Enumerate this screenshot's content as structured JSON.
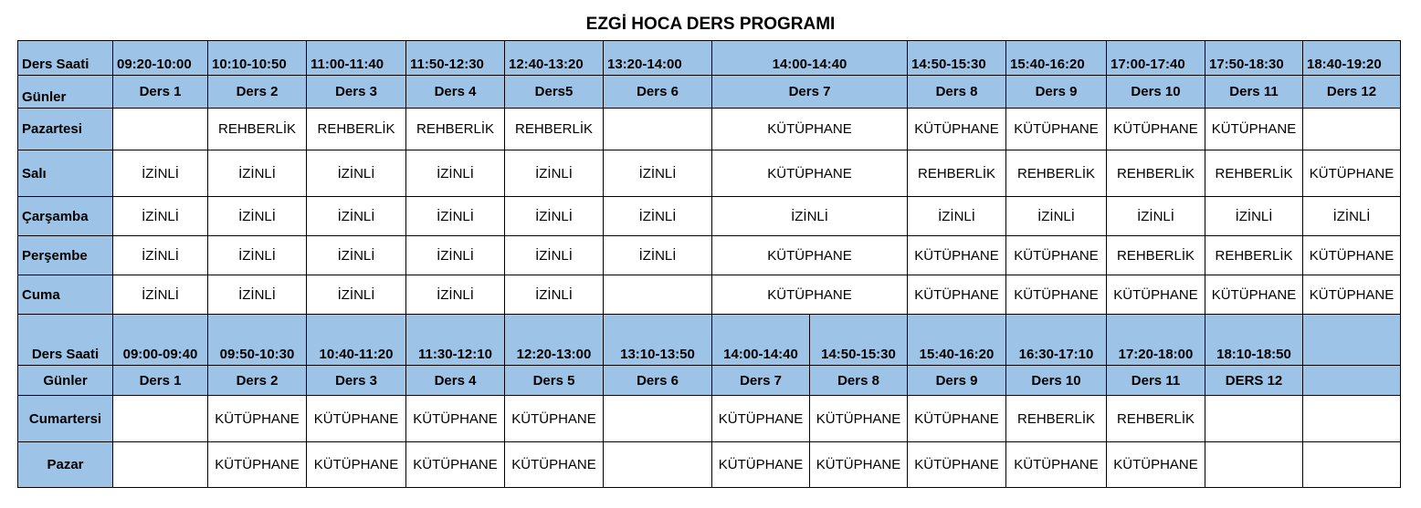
{
  "title": "EZGİ HOCA DERS PROGRAMI",
  "weekday": {
    "slot_header": "Ders Saati",
    "day_header": "Günler",
    "times": [
      "09:20-10:00",
      "10:10-10:50",
      "11:00-11:40",
      "11:50-12:30",
      "12:40-13:20",
      "13:20-14:00",
      "14:00-14:40",
      "14:50-15:30",
      "15:40-16:20",
      "17:00-17:40",
      "17:50-18:30",
      "18:40-19:20"
    ],
    "lessons": [
      "Ders 1",
      "Ders 2",
      "Ders 3",
      "Ders 4",
      "Ders5",
      "Ders 6",
      "Ders 7",
      "Ders 8",
      "Ders 9",
      "Ders 10",
      "Ders 11",
      "Ders 12"
    ],
    "rows": [
      {
        "day": "Pazartesi",
        "cells": [
          "",
          "REHBERLİK",
          "REHBERLİK",
          "REHBERLİK",
          "REHBERLİK",
          "",
          "KÜTÜPHANE",
          "KÜTÜPHANE",
          "KÜTÜPHANE",
          "KÜTÜPHANE",
          "KÜTÜPHANE",
          ""
        ]
      },
      {
        "day": "Salı",
        "cells": [
          "İZİNLİ",
          "İZİNLİ",
          "İZİNLİ",
          "İZİNLİ",
          "İZİNLİ",
          "İZİNLİ",
          "KÜTÜPHANE",
          "REHBERLİK",
          "REHBERLİK",
          "REHBERLİK",
          "REHBERLİK",
          "KÜTÜPHANE"
        ]
      },
      {
        "day": "Çarşamba",
        "cells": [
          "İZİNLİ",
          "İZİNLİ",
          "İZİNLİ",
          "İZİNLİ",
          "İZİNLİ",
          "İZİNLİ",
          "İZİNLİ",
          "İZİNLİ",
          "İZİNLİ",
          "İZİNLİ",
          "İZİNLİ",
          "İZİNLİ"
        ]
      },
      {
        "day": "Perşembe",
        "cells": [
          "İZİNLİ",
          "İZİNLİ",
          "İZİNLİ",
          "İZİNLİ",
          "İZİNLİ",
          "İZİNLİ",
          "KÜTÜPHANE",
          "KÜTÜPHANE",
          "KÜTÜPHANE",
          "REHBERLİK",
          "REHBERLİK",
          "KÜTÜPHANE"
        ]
      },
      {
        "day": "Cuma",
        "cells": [
          "İZİNLİ",
          "İZİNLİ",
          "İZİNLİ",
          "İZİNLİ",
          "İZİNLİ",
          "",
          "KÜTÜPHANE",
          "KÜTÜPHANE",
          "KÜTÜPHANE",
          "KÜTÜPHANE",
          "KÜTÜPHANE",
          "KÜTÜPHANE"
        ]
      }
    ]
  },
  "weekend": {
    "slot_header": "Ders Saati",
    "day_header": "Günler",
    "times": [
      "09:00-09:40",
      "09:50-10:30",
      "10:40-11:20",
      "11:30-12:10",
      "12:20-13:00",
      "13:10-13:50",
      "14:00-14:40",
      "14:50-15:30",
      "15:40-16:20",
      "16:30-17:10",
      "17:20-18:00",
      "18:10-18:50",
      ""
    ],
    "lessons": [
      "Ders 1",
      "Ders 2",
      "Ders 3",
      "Ders 4",
      "Ders 5",
      "Ders 6",
      "Ders 7",
      "Ders 8",
      "Ders 9",
      "Ders 10",
      "Ders 11",
      "DERS 12",
      ""
    ],
    "rows": [
      {
        "day": "Cumartersi",
        "cells": [
          "",
          "KÜTÜPHANE",
          "KÜTÜPHANE",
          "KÜTÜPHANE",
          "KÜTÜPHANE",
          "",
          "KÜTÜPHANE",
          "KÜTÜPHANE",
          "KÜTÜPHANE",
          "REHBERLİK",
          "REHBERLİK",
          "",
          ""
        ]
      },
      {
        "day": "Pazar",
        "cells": [
          "",
          "KÜTÜPHANE",
          "KÜTÜPHANE",
          "KÜTÜPHANE",
          "KÜTÜPHANE",
          "",
          "KÜTÜPHANE",
          "KÜTÜPHANE",
          "KÜTÜPHANE",
          "KÜTÜPHANE",
          "KÜTÜPHANE",
          "",
          ""
        ]
      }
    ]
  },
  "colors": {
    "header_fill": "#9dc3e6",
    "border": "#000000"
  }
}
